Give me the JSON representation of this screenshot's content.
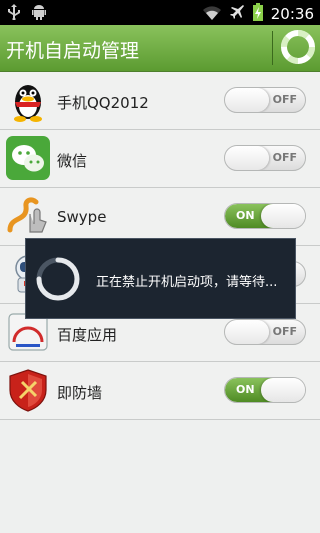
{
  "status_bar": {
    "time": "20:36",
    "icons": [
      "usb-icon",
      "android-debug-icon",
      "wifi-icon",
      "airplane-icon",
      "battery-charging-icon"
    ]
  },
  "app_bar": {
    "title": "开机自启动管理",
    "action_icon": "ring-icon"
  },
  "apps": [
    {
      "name": "手机QQ2012",
      "state": "OFF",
      "icon": "qq-penguin-icon"
    },
    {
      "name": "微信",
      "state": "OFF",
      "icon": "wechat-icon"
    },
    {
      "name": "Swype",
      "state": "ON",
      "icon": "swype-icon"
    },
    {
      "name": "",
      "state": "",
      "icon": "astronaut-icon"
    },
    {
      "name": "百度应用",
      "state": "OFF",
      "icon": "baidu-app-icon"
    },
    {
      "name": "即防墙",
      "state": "ON",
      "icon": "firewall-shield-icon"
    }
  ],
  "dialog": {
    "message": "正在禁止开机启动项，请等待..."
  },
  "colors": {
    "accent": "#6aa93f",
    "dialog_bg": "#1c2530"
  }
}
